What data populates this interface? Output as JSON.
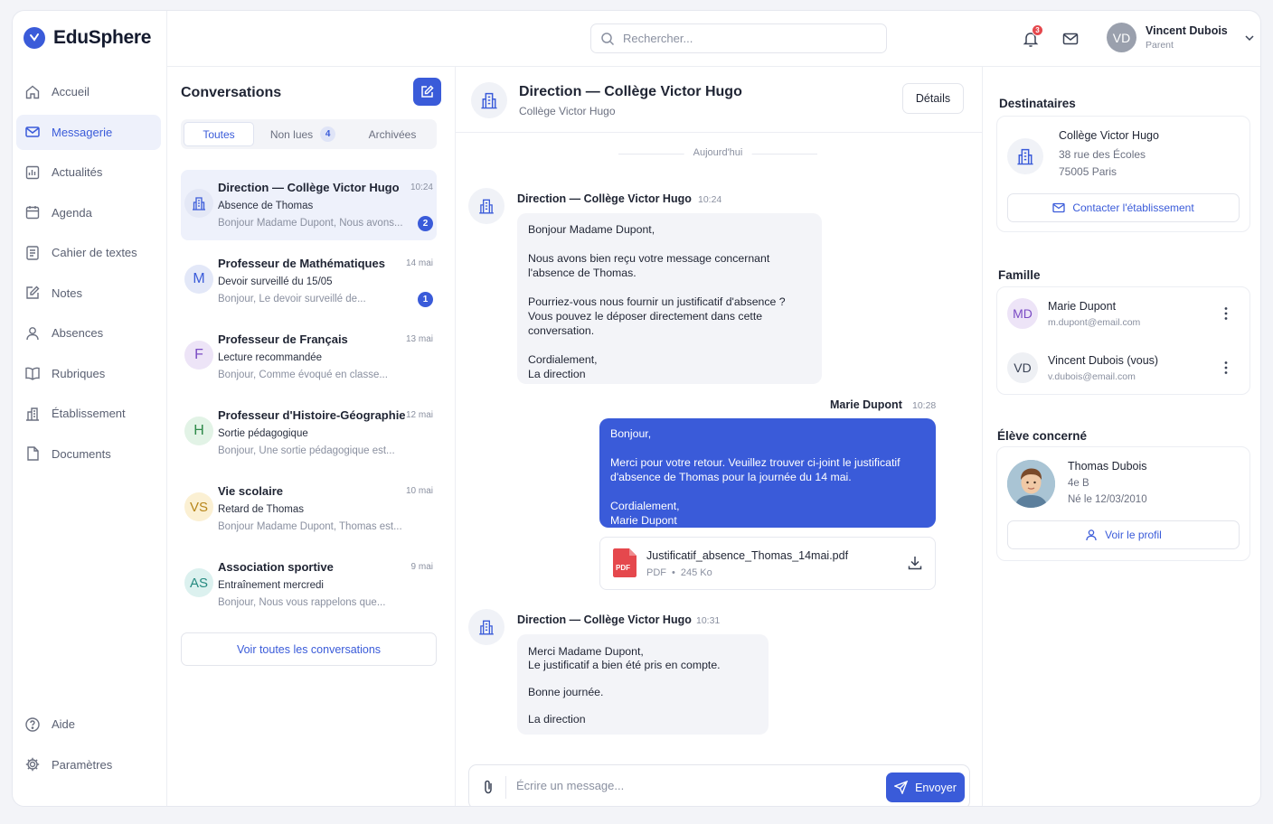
{
  "app": {
    "name": "EduSphere",
    "accent": "#3a5bd9"
  },
  "sidebar": {
    "items": [
      {
        "label": "Accueil",
        "icon": "home-icon"
      },
      {
        "label": "Messagerie",
        "icon": "mail-icon",
        "active": true
      },
      {
        "label": "Actualités",
        "icon": "news-icon"
      },
      {
        "label": "Agenda",
        "icon": "calendar-icon"
      },
      {
        "label": "Cahier de textes",
        "icon": "notebook-icon"
      },
      {
        "label": "Notes",
        "icon": "edit-icon"
      },
      {
        "label": "Absences",
        "icon": "user-icon"
      },
      {
        "label": "Rubriques",
        "icon": "book-icon"
      },
      {
        "label": "Établissement",
        "icon": "building-icon"
      },
      {
        "label": "Documents",
        "icon": "file-icon"
      }
    ],
    "bottom": [
      {
        "label": "Aide",
        "icon": "help-icon"
      },
      {
        "label": "Paramètres",
        "icon": "gear-icon"
      }
    ]
  },
  "topbar": {
    "search_placeholder": "Rechercher...",
    "notification_count": "3",
    "user": {
      "initials": "VD",
      "name": "Vincent Dubois",
      "role": "Parent"
    }
  },
  "conversations": {
    "title": "Conversations",
    "tabs": [
      {
        "label": "Toutes",
        "active": true
      },
      {
        "label": "Non lues",
        "count": "4"
      },
      {
        "label": "Archivées"
      }
    ],
    "items": [
      {
        "avatar": "building-icon",
        "name": "Direction — Collège Victor Hugo",
        "time": "10:24",
        "subject": "Absence de Thomas",
        "preview": "Bonjour Madame Dupont, Nous avons...",
        "unread": "2",
        "selected": true
      },
      {
        "avatar": "M",
        "avatar_bg": "#e3e8f8",
        "avatar_fg": "#3a5bd9",
        "name": "Professeur de Mathématiques",
        "time": "14 mai",
        "subject": "Devoir surveillé du 15/05",
        "preview": "Bonjour, Le devoir surveillé de...",
        "unread": "1"
      },
      {
        "avatar": "F",
        "avatar_bg": "#ede4f7",
        "avatar_fg": "#7a4bc4",
        "name": "Professeur de Français",
        "time": "13 mai",
        "subject": "Lecture recommandée",
        "preview": "Bonjour, Comme évoqué en classe..."
      },
      {
        "avatar": "H",
        "avatar_bg": "#e2f3e6",
        "avatar_fg": "#2f8a4a",
        "name": "Professeur d'Histoire-Géographie",
        "time": "12 mai",
        "subject": "Sortie pédagogique",
        "preview": "Bonjour, Une sortie pédagogique est..."
      },
      {
        "avatar": "VS",
        "avatar_bg": "#fbf0d3",
        "avatar_fg": "#b7861a",
        "name": "Vie scolaire",
        "time": "10 mai",
        "subject": "Retard de Thomas",
        "preview": "Bonjour Madame Dupont, Thomas est..."
      },
      {
        "avatar": "AS",
        "avatar_bg": "#dcf1ef",
        "avatar_fg": "#268a80",
        "name": "Association sportive",
        "time": "9 mai",
        "subject": "Entraînement mercredi",
        "preview": "Bonjour, Nous vous rappelons que..."
      }
    ],
    "see_all": "Voir toutes les conversations"
  },
  "chat": {
    "title": "Direction — Collège Victor Hugo",
    "subtitle": "Collège Victor Hugo",
    "details_label": "Détails",
    "date_separator": "Aujourd'hui",
    "messages": [
      {
        "author": "Direction — Collège Victor Hugo",
        "time": "10:24",
        "text": "Bonjour Madame Dupont,\n\nNous avons bien reçu votre message concernant\nl'absence de Thomas.\n\nPourriez-vous nous fournir un justificatif d'absence ?\nVous pouvez le déposer directement dans cette\nconversation.\n\nCordialement,\nLa direction"
      },
      {
        "author": "Marie Dupont",
        "time": "10:28",
        "text": "Bonjour,\n\nMerci pour votre retour. Veuillez trouver ci-joint le justificatif\nd'absence de Thomas pour la journée du 14 mai.\n\nCordialement,\nMarie Dupont",
        "attachment": {
          "name": "Justificatif_absence_Thomas_14mai.pdf",
          "type": "PDF",
          "size": "245 Ko",
          "badge": "PDF"
        }
      },
      {
        "author": "Direction — Collège Victor Hugo",
        "time": "10:31",
        "text": "Merci Madame Dupont,\nLe justificatif a bien été pris en compte.\n\nBonne journée.\n\nLa direction"
      }
    ],
    "composer_placeholder": "Écrire un message...",
    "send_label": "Envoyer"
  },
  "right": {
    "recipients_title": "Destinataires",
    "school": {
      "name": "Collège Victor Hugo",
      "address1": "38 rue des Écoles",
      "address2": "75005 Paris",
      "contact_label": "Contacter l'établissement"
    },
    "family_title": "Famille",
    "family": [
      {
        "initials": "MD",
        "name": "Marie Dupont",
        "email": "m.dupont@email.com",
        "bg": "#ede4f7",
        "fg": "#7a4bc4"
      },
      {
        "initials": "VD",
        "name": "Vincent Dubois (vous)",
        "email": "v.dubois@email.com",
        "bg": "#eef0f4",
        "fg": "#3a4255"
      }
    ],
    "student_title": "Élève concerné",
    "student": {
      "name": "Thomas Dubois",
      "class": "4e B",
      "birth": "Né le 12/03/2010",
      "profile_label": "Voir le profil"
    }
  }
}
